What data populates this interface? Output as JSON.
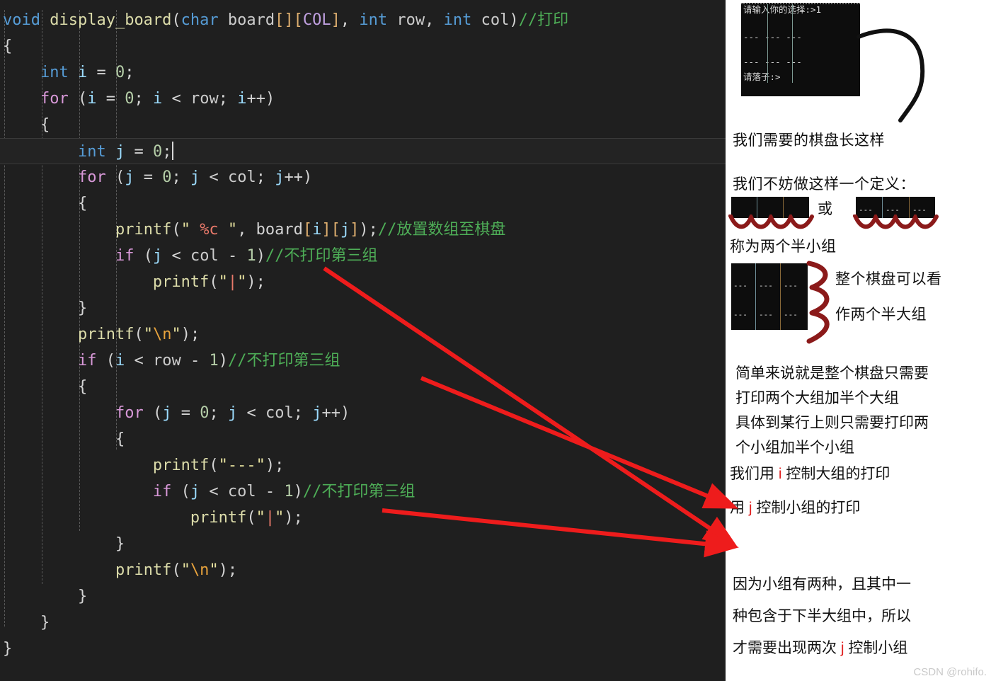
{
  "editor": {
    "language": "c",
    "lines": [
      [
        {
          "t": "void ",
          "c": "kw"
        },
        {
          "t": "display_board",
          "c": "fn"
        },
        {
          "t": "(",
          "c": "punc"
        },
        {
          "t": "char",
          "c": "kw"
        },
        {
          "t": " board",
          "c": "plain"
        },
        {
          "t": "[][",
          "c": "brk2"
        },
        {
          "t": "COL",
          "c": "type"
        },
        {
          "t": "]",
          "c": "brk2"
        },
        {
          "t": ", ",
          "c": "punc"
        },
        {
          "t": "int",
          "c": "kw"
        },
        {
          "t": " row",
          "c": "plain"
        },
        {
          "t": ", ",
          "c": "punc"
        },
        {
          "t": "int",
          "c": "kw"
        },
        {
          "t": " col",
          "c": "plain"
        },
        {
          "t": ")",
          "c": "punc"
        },
        {
          "t": "//打印",
          "c": "cmt"
        }
      ],
      [
        {
          "t": "{",
          "c": "brk"
        }
      ],
      [
        {
          "t": "    ",
          "c": "plain"
        },
        {
          "t": "int",
          "c": "kw"
        },
        {
          "t": " i ",
          "c": "var"
        },
        {
          "t": "= ",
          "c": "punc"
        },
        {
          "t": "0",
          "c": "num"
        },
        {
          "t": ";",
          "c": "punc"
        }
      ],
      [
        {
          "t": "    ",
          "c": "plain"
        },
        {
          "t": "for",
          "c": "ctl"
        },
        {
          "t": " (",
          "c": "punc"
        },
        {
          "t": "i",
          "c": "var"
        },
        {
          "t": " = ",
          "c": "punc"
        },
        {
          "t": "0",
          "c": "num"
        },
        {
          "t": "; ",
          "c": "punc"
        },
        {
          "t": "i",
          "c": "var"
        },
        {
          "t": " < ",
          "c": "punc"
        },
        {
          "t": "row",
          "c": "plain"
        },
        {
          "t": "; ",
          "c": "punc"
        },
        {
          "t": "i",
          "c": "var"
        },
        {
          "t": "++)",
          "c": "punc"
        }
      ],
      [
        {
          "t": "    ",
          "c": "plain"
        },
        {
          "t": "{",
          "c": "brk"
        }
      ],
      [
        {
          "t": "        ",
          "c": "plain"
        },
        {
          "t": "int",
          "c": "kw"
        },
        {
          "t": " j ",
          "c": "var"
        },
        {
          "t": "= ",
          "c": "punc"
        },
        {
          "t": "0",
          "c": "num"
        },
        {
          "t": ";",
          "c": "punc"
        }
      ],
      [
        {
          "t": "        ",
          "c": "plain"
        },
        {
          "t": "for",
          "c": "ctl"
        },
        {
          "t": " (",
          "c": "punc"
        },
        {
          "t": "j",
          "c": "var"
        },
        {
          "t": " = ",
          "c": "punc"
        },
        {
          "t": "0",
          "c": "num"
        },
        {
          "t": "; ",
          "c": "punc"
        },
        {
          "t": "j",
          "c": "var"
        },
        {
          "t": " < ",
          "c": "punc"
        },
        {
          "t": "col",
          "c": "plain"
        },
        {
          "t": "; ",
          "c": "punc"
        },
        {
          "t": "j",
          "c": "var"
        },
        {
          "t": "++)",
          "c": "punc"
        }
      ],
      [
        {
          "t": "        ",
          "c": "plain"
        },
        {
          "t": "{",
          "c": "brk"
        }
      ],
      [
        {
          "t": "            ",
          "c": "plain"
        },
        {
          "t": "printf",
          "c": "fn"
        },
        {
          "t": "(",
          "c": "punc"
        },
        {
          "t": "\" ",
          "c": "str"
        },
        {
          "t": "%c",
          "c": "fmt"
        },
        {
          "t": " \"",
          "c": "str"
        },
        {
          "t": ", board",
          "c": "punc"
        },
        {
          "t": "[",
          "c": "brk2"
        },
        {
          "t": "i",
          "c": "var"
        },
        {
          "t": "][",
          "c": "brk2"
        },
        {
          "t": "j",
          "c": "var"
        },
        {
          "t": "]",
          "c": "brk2"
        },
        {
          "t": ");",
          "c": "punc"
        },
        {
          "t": "//放置数组至棋盘",
          "c": "cmt"
        }
      ],
      [
        {
          "t": "            ",
          "c": "plain"
        },
        {
          "t": "if",
          "c": "ctl"
        },
        {
          "t": " (",
          "c": "punc"
        },
        {
          "t": "j",
          "c": "var"
        },
        {
          "t": " < ",
          "c": "punc"
        },
        {
          "t": "col",
          "c": "plain"
        },
        {
          "t": " - ",
          "c": "punc"
        },
        {
          "t": "1",
          "c": "num"
        },
        {
          "t": ")",
          "c": "punc"
        },
        {
          "t": "//不打印第三组",
          "c": "cmt"
        }
      ],
      [
        {
          "t": "                ",
          "c": "plain"
        },
        {
          "t": "printf",
          "c": "fn"
        },
        {
          "t": "(",
          "c": "punc"
        },
        {
          "t": "\"",
          "c": "str"
        },
        {
          "t": "|",
          "c": "pipe"
        },
        {
          "t": "\"",
          "c": "str"
        },
        {
          "t": ");",
          "c": "punc"
        }
      ],
      [
        {
          "t": "        ",
          "c": "plain"
        },
        {
          "t": "}",
          "c": "brk"
        }
      ],
      [
        {
          "t": "        ",
          "c": "plain"
        },
        {
          "t": "printf",
          "c": "fn"
        },
        {
          "t": "(",
          "c": "punc"
        },
        {
          "t": "\"",
          "c": "str"
        },
        {
          "t": "\\n",
          "c": "esc"
        },
        {
          "t": "\"",
          "c": "str"
        },
        {
          "t": ");",
          "c": "punc"
        }
      ],
      [
        {
          "t": "        ",
          "c": "plain"
        },
        {
          "t": "if",
          "c": "ctl"
        },
        {
          "t": " (",
          "c": "punc"
        },
        {
          "t": "i",
          "c": "var"
        },
        {
          "t": " < ",
          "c": "punc"
        },
        {
          "t": "row",
          "c": "plain"
        },
        {
          "t": " - ",
          "c": "punc"
        },
        {
          "t": "1",
          "c": "num"
        },
        {
          "t": ")",
          "c": "punc"
        },
        {
          "t": "//不打印第三组",
          "c": "cmt"
        }
      ],
      [
        {
          "t": "        ",
          "c": "plain"
        },
        {
          "t": "{",
          "c": "brk"
        }
      ],
      [
        {
          "t": "            ",
          "c": "plain"
        },
        {
          "t": "for",
          "c": "ctl"
        },
        {
          "t": " (",
          "c": "punc"
        },
        {
          "t": "j",
          "c": "var"
        },
        {
          "t": " = ",
          "c": "punc"
        },
        {
          "t": "0",
          "c": "num"
        },
        {
          "t": "; ",
          "c": "punc"
        },
        {
          "t": "j",
          "c": "var"
        },
        {
          "t": " < ",
          "c": "punc"
        },
        {
          "t": "col",
          "c": "plain"
        },
        {
          "t": "; ",
          "c": "punc"
        },
        {
          "t": "j",
          "c": "var"
        },
        {
          "t": "++)",
          "c": "punc"
        }
      ],
      [
        {
          "t": "            ",
          "c": "plain"
        },
        {
          "t": "{",
          "c": "brk"
        }
      ],
      [
        {
          "t": "                ",
          "c": "plain"
        },
        {
          "t": "printf",
          "c": "fn"
        },
        {
          "t": "(",
          "c": "punc"
        },
        {
          "t": "\"---\"",
          "c": "str"
        },
        {
          "t": ");",
          "c": "punc"
        }
      ],
      [
        {
          "t": "                ",
          "c": "plain"
        },
        {
          "t": "if",
          "c": "ctl"
        },
        {
          "t": " (",
          "c": "punc"
        },
        {
          "t": "j",
          "c": "var"
        },
        {
          "t": " < ",
          "c": "punc"
        },
        {
          "t": "col",
          "c": "plain"
        },
        {
          "t": " - ",
          "c": "punc"
        },
        {
          "t": "1",
          "c": "num"
        },
        {
          "t": ")",
          "c": "punc"
        },
        {
          "t": "//不打印第三组",
          "c": "cmt"
        }
      ],
      [
        {
          "t": "                    ",
          "c": "plain"
        },
        {
          "t": "printf",
          "c": "fn"
        },
        {
          "t": "(",
          "c": "punc"
        },
        {
          "t": "\"",
          "c": "str"
        },
        {
          "t": "|",
          "c": "pipe"
        },
        {
          "t": "\"",
          "c": "str"
        },
        {
          "t": ");",
          "c": "punc"
        }
      ],
      [
        {
          "t": "            ",
          "c": "plain"
        },
        {
          "t": "}",
          "c": "brk"
        }
      ],
      [
        {
          "t": "            ",
          "c": "plain"
        },
        {
          "t": "printf",
          "c": "fn"
        },
        {
          "t": "(",
          "c": "punc"
        },
        {
          "t": "\"",
          "c": "str"
        },
        {
          "t": "\\n",
          "c": "esc"
        },
        {
          "t": "\"",
          "c": "str"
        },
        {
          "t": ");",
          "c": "punc"
        }
      ],
      [
        {
          "t": "        ",
          "c": "plain"
        },
        {
          "t": "}",
          "c": "brk"
        }
      ],
      [
        {
          "t": "    ",
          "c": "plain"
        },
        {
          "t": "}",
          "c": "brk"
        }
      ],
      [
        {
          "t": "}",
          "c": "brk"
        }
      ]
    ],
    "active_line_index": 5,
    "colors": {
      "background": "#1f1f1f",
      "active_line": "#232323",
      "comment": "#4eae57",
      "keyword": "#569cd6",
      "control": "#d898d8",
      "function": "#dcdcaa",
      "string": "#e8e3a0",
      "number": "#b5cea8",
      "variable": "#9cdcfe"
    }
  },
  "console": {
    "prompt_line": "请输入你的选择:>1",
    "footer_line": "请落子:>",
    "dash_row": "--- --- ---",
    "rows": 2,
    "columns": 3
  },
  "panel": {
    "caption_board": "我们需要的棋盘长这样",
    "caption_define": "我们不妨做这样一个定义：",
    "or_label": "或",
    "caption_small_group": "称为两个半小组",
    "caption_big_1": "整个棋盘可以看",
    "caption_big_2": "作两个半大组",
    "paragraph_1": [
      "简单来说就是整个棋盘只需要",
      "打印两个大组加半个大组",
      "具体到某行上则只需要打印两",
      "个小组加半个小组"
    ],
    "line_i": {
      "pre": "我们用 ",
      "var": "i",
      "post": " 控制大组的打印"
    },
    "line_j": {
      "pre": "用 ",
      "var": "j",
      "post": " 控制小组的打印"
    },
    "paragraph_2_a": "因为小组有两种，且其中一",
    "paragraph_2_b": "种包含于下半大组中，所以",
    "paragraph_2_c_pre": "才需要出现两次 ",
    "paragraph_2_c_var": "j",
    "paragraph_2_c_post": " 控制小组",
    "watermark": "CSDN @rohifo.",
    "arrow_color": "#ee1c1c",
    "brace_color": "#8b1a1a"
  }
}
